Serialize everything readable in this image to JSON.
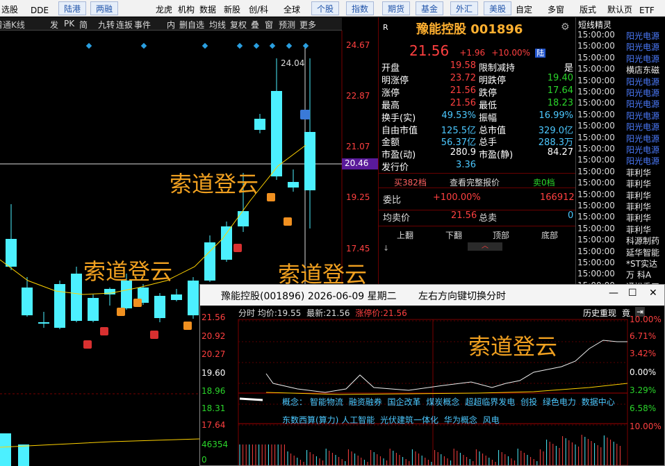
{
  "toolbar": {
    "items": [
      "选股",
      "DDE",
      "陆港",
      "两融",
      "龙虎",
      "机构",
      "数据",
      "新股",
      "创/科",
      "全球",
      "个股",
      "指数",
      "期货",
      "基金",
      "外汇",
      "美股",
      "自定",
      "多窗",
      "版式",
      "默认页",
      "ETF"
    ]
  },
  "subtools": {
    "kline_label": "普通K线",
    "items": [
      "发",
      "PK",
      "简",
      "九转",
      "连扳",
      "事件",
      "内",
      "删自选",
      "均线",
      "复权",
      "叠",
      "窗",
      "预测",
      "更多"
    ]
  },
  "axis": {
    "price_ticks": [
      "24.67",
      "22.87",
      "21.07",
      "19.25",
      "17.45"
    ],
    "current_marker": "20.46",
    "high_label": "24.04"
  },
  "watermark": "索道登云",
  "quote": {
    "name": "豫能控股",
    "code": "001896",
    "price": "21.56",
    "change": "+1.96",
    "pct": "+10.00%",
    "tag": "陆",
    "r_label": "R",
    "rows": [
      [
        "开盘",
        "19.58",
        "限制减持",
        "是"
      ],
      [
        "明涨停",
        "23.72",
        "明跌停",
        "19.40"
      ],
      [
        "涨停",
        "21.56",
        "跌停",
        "17.64"
      ],
      [
        "最高",
        "21.56",
        "最低",
        "18.23"
      ],
      [
        "换手(实)",
        "49.53%",
        "振幅",
        "16.99%"
      ],
      [
        "自由市值",
        "125.5亿",
        "总市值",
        "329.0亿"
      ],
      [
        "金额",
        "56.37亿",
        "总手",
        "288.3万"
      ],
      [
        "市盈(动)",
        "280.9",
        "市盈(静)",
        "84.27"
      ],
      [
        "发行价",
        "3.36",
        "",
        ""
      ]
    ],
    "buy_label": "买382档",
    "full_label": "查看完整报价",
    "sell_label": "卖0档",
    "weibi_label": "委比",
    "weibi_val": "+100.00%",
    "weibi_num": "166912",
    "avg_label": "均卖价",
    "avg_val": "21.56",
    "total_sell_label": "总卖",
    "total_sell_val": "0",
    "nav": [
      "上翻",
      "下翻",
      "顶部",
      "底部"
    ]
  },
  "news": {
    "title": "短线精灵",
    "items": [
      [
        "15:00:00",
        "阳光电源"
      ],
      [
        "15:00:00",
        "阳光电源"
      ],
      [
        "15:00:00",
        "阳光电源"
      ],
      [
        "15:00:00",
        "横店东磁"
      ],
      [
        "15:00:00",
        "阳光电源"
      ],
      [
        "15:00:00",
        "阳光电源"
      ],
      [
        "15:00:00",
        "阳光电源"
      ],
      [
        "15:00:00",
        "阳光电源"
      ],
      [
        "15:00:00",
        "阳光电源"
      ],
      [
        "15:00:00",
        "阳光电源"
      ],
      [
        "15:00:00",
        "阳光电源"
      ],
      [
        "15:00:00",
        "阳光电源"
      ],
      [
        "15:00:00",
        "菲利华"
      ],
      [
        "15:00:00",
        "菲利华"
      ],
      [
        "15:00:00",
        "菲利华"
      ],
      [
        "15:00:00",
        "菲利华"
      ],
      [
        "15:00:00",
        "菲利华"
      ],
      [
        "15:00:00",
        "菲利华"
      ],
      [
        "15:00:00",
        "科源制药"
      ],
      [
        "15:00:00",
        "延华智能"
      ],
      [
        "15:00:00",
        "*ST实达"
      ],
      [
        "15:00:00",
        "万 科A"
      ],
      [
        "15:00:00",
        "通裕重工"
      ]
    ]
  },
  "popup": {
    "title": "豫能控股(001896) 2026-06-09 星期二",
    "hint": "左右方向键切换分时",
    "fenshi": "分时",
    "avg_label": "均价:",
    "avg": "19.55",
    "last_label": "最新:",
    "last": "21.56",
    "limit_label": "涨停价:",
    "limit": "21.56",
    "replay": "历史重现",
    "jing": "竟",
    "left_ticks": [
      "21.56",
      "20.92",
      "20.27",
      "19.60",
      "18.96",
      "18.31",
      "17.64",
      "46354",
      "0"
    ],
    "right_ticks": [
      "10.00%",
      "6.71%",
      "3.42%",
      "0.00%",
      "3.29%",
      "6.58%",
      "10.00%"
    ],
    "concepts1": [
      "概念：",
      "智能物流",
      "融资融券",
      "国企改革",
      "煤炭概念",
      "超超临界发电",
      "创投",
      "绿色电力",
      "数据中心"
    ],
    "concepts2": [
      "东数西算(算力)",
      "人工智能",
      "光伏建筑一体化",
      "华为概念",
      "风电"
    ]
  }
}
